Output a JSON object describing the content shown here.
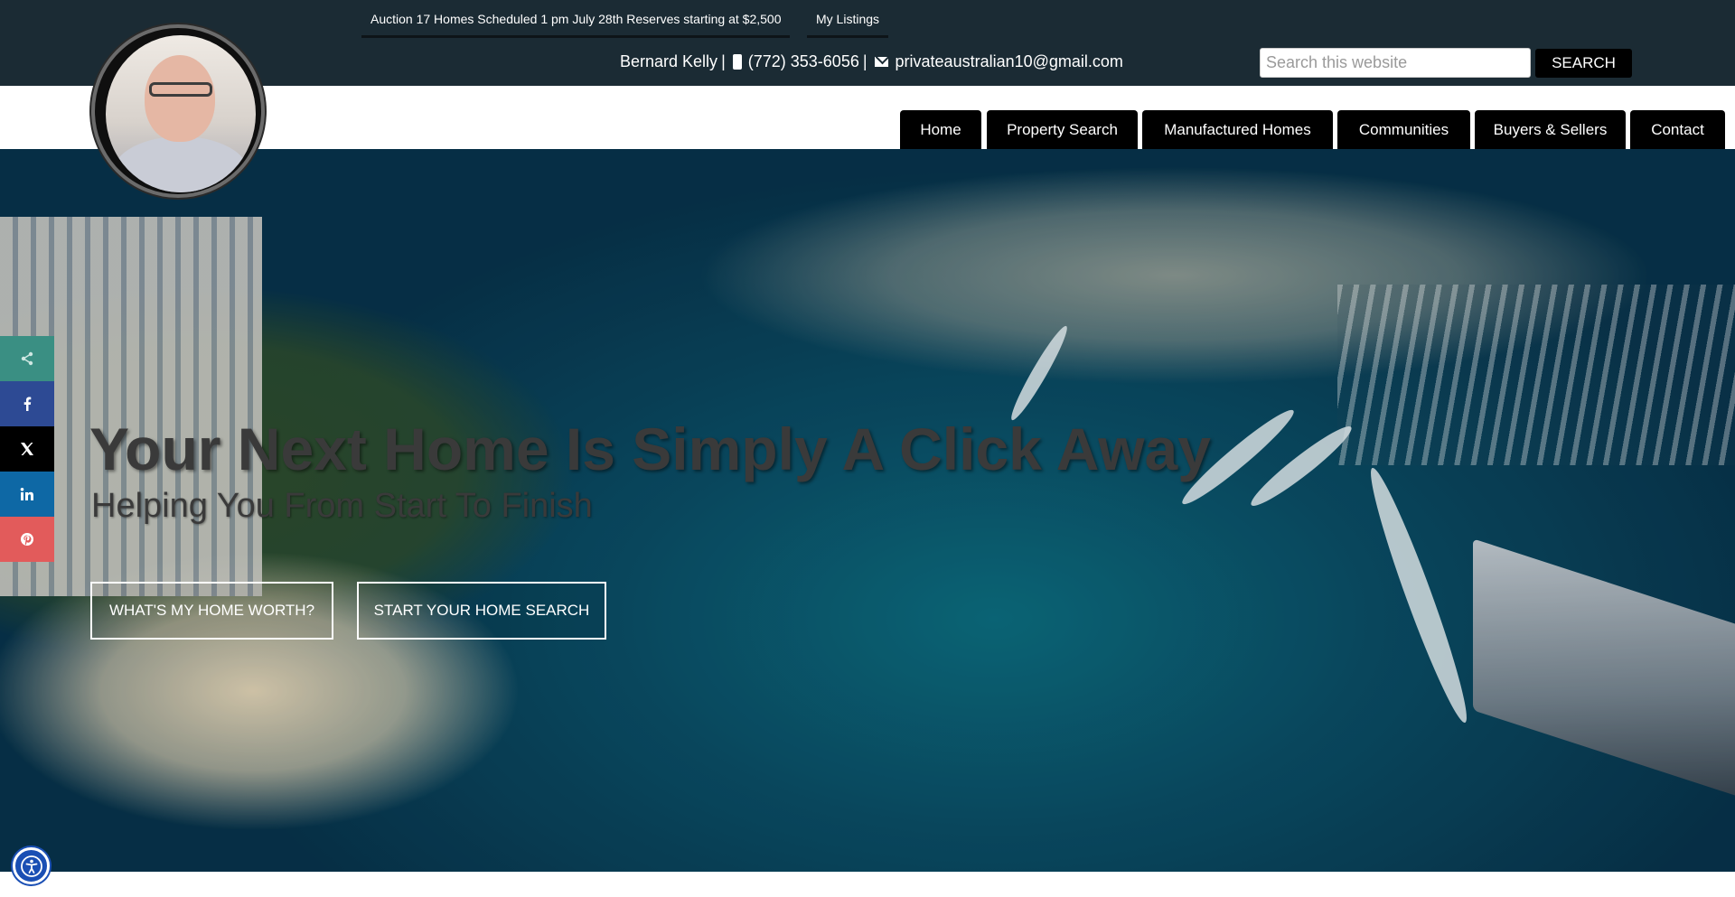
{
  "topbar": {
    "auction_link": "Auction 17 Homes Scheduled 1 pm July 28th Reserves starting at $2,500",
    "listings_link": "My Listings",
    "agent_name": "Bernard Kelly",
    "separator": "|",
    "phone": "(772) 353-6056",
    "email": "privateaustralian10@gmail.com",
    "search_placeholder": "Search this website",
    "search_button": "SEARCH"
  },
  "nav": {
    "items": [
      {
        "label": "Home"
      },
      {
        "label": "Property Search"
      },
      {
        "label": "Manufactured Homes"
      },
      {
        "label": "Communities"
      },
      {
        "label": "Buyers & Sellers"
      },
      {
        "label": "Contact"
      }
    ]
  },
  "hero": {
    "title": "Your Next Home Is Simply A Click Away",
    "subtitle": "Helping You From Start To Finish",
    "button_worth": "WHAT'S MY HOME WORTH?",
    "button_search": "START YOUR HOME SEARCH"
  },
  "social": [
    {
      "icon": "share-icon",
      "color": "#3a8f83"
    },
    {
      "icon": "facebook-icon",
      "color": "#2d4a94"
    },
    {
      "icon": "x-icon",
      "color": "#000000"
    },
    {
      "icon": "linkedin-icon",
      "color": "#0e68a5"
    },
    {
      "icon": "pinterest-icon",
      "color": "#e25b5b"
    }
  ],
  "colors": {
    "topbar_bg": "#1b2b34",
    "nav_button_bg": "#000000",
    "accessibility_blue": "#1a4fb4"
  }
}
